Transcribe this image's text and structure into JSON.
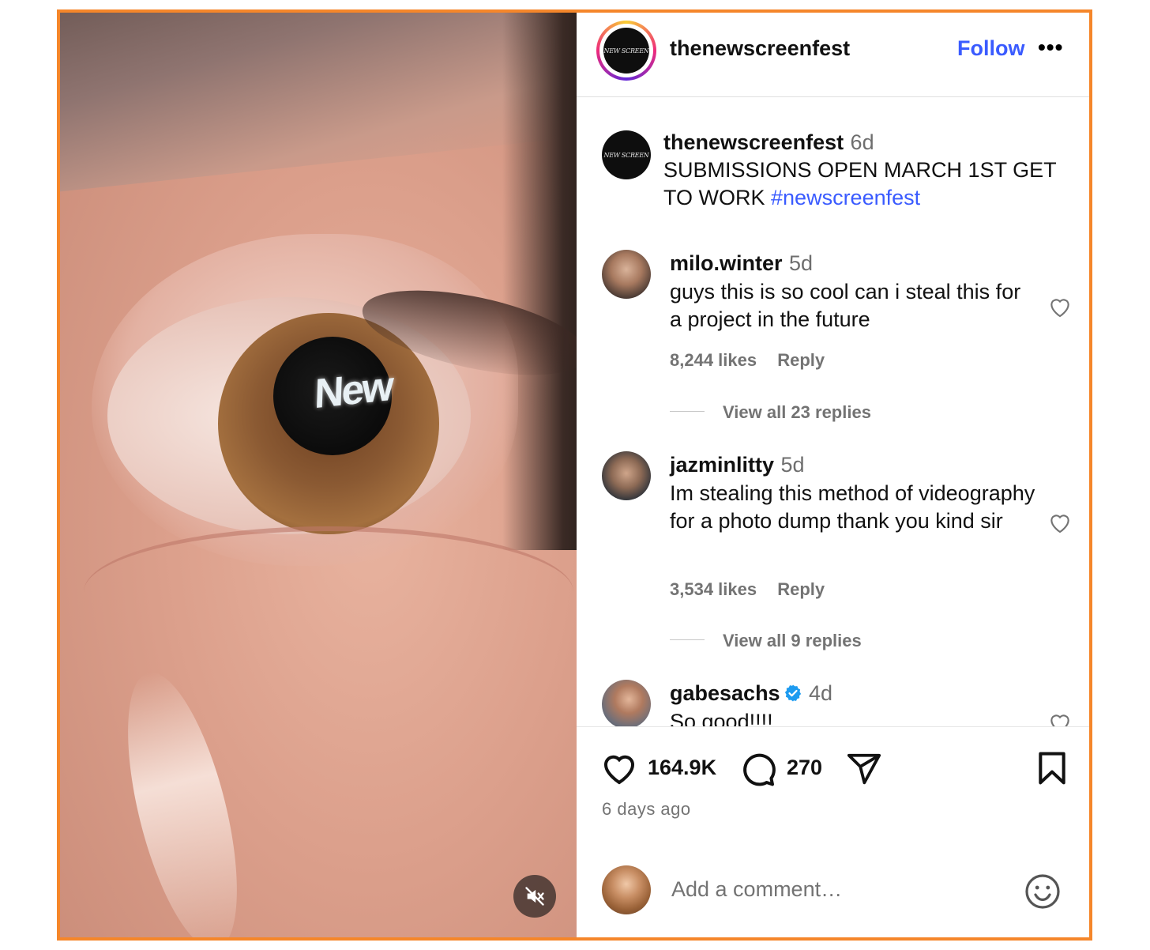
{
  "post": {
    "author": "thenewscreenfest",
    "follow_label": "Follow",
    "more_label": "•••",
    "avatar_logo_text": "NEW SCREEN",
    "media_reflection_text": "New",
    "caption": {
      "username": "thenewscreenfest",
      "time": "6d",
      "text": "SUBMISSIONS OPEN MARCH 1ST GET TO WORK ",
      "hashtag": "#newscreenfest"
    }
  },
  "comments": [
    {
      "username": "milo.winter",
      "time": "5d",
      "text": "guys this is so cool can i steal this for a project in the future",
      "likes": "8,244 likes",
      "reply": "Reply",
      "view_replies": "View all 23 replies"
    },
    {
      "username": "jazminlitty",
      "time": "5d",
      "text": "Im stealing this method of videography for a photo dump thank you kind sir",
      "likes": "3,534 likes",
      "reply": "Reply",
      "view_replies": "View all 9 replies"
    },
    {
      "username": "gabesachs",
      "time": "4d",
      "verified": true,
      "text": "So good!!!!"
    }
  ],
  "actions": {
    "like_count": "164.9K",
    "comment_count": "270",
    "posted_ago": "6 days ago"
  },
  "composer": {
    "placeholder": "Add a comment…"
  },
  "colors": {
    "frame_border": "#f5862a",
    "link_blue": "#3a5bff",
    "muted_text": "#737373",
    "verified_blue": "#1d9bf0"
  },
  "icons": [
    "mute-icon",
    "more-icon",
    "heart-icon",
    "comment-icon",
    "share-icon",
    "bookmark-icon",
    "emoji-icon",
    "verified-icon"
  ]
}
